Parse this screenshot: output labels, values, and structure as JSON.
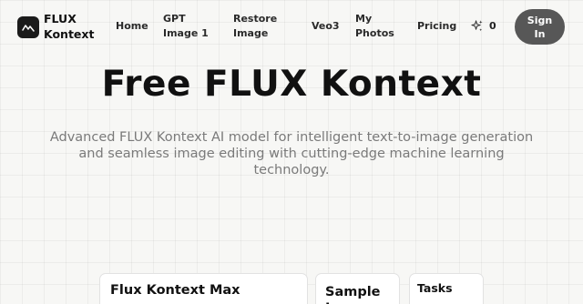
{
  "brand": {
    "line1": "FLUX",
    "line2": "Kontext"
  },
  "nav": {
    "home": "Home",
    "gpt_line1": "GPT",
    "gpt_line2": "Image 1",
    "restore_line1": "Restore",
    "restore_line2": "Image",
    "veo": "Veo3",
    "photos_line1": "My",
    "photos_line2": "Photos",
    "pricing": "Pricing",
    "credits": "0",
    "signin_line1": "Sign",
    "signin_line2": "In"
  },
  "hero": {
    "title": "Free FLUX Kontext",
    "subtitle_line1": "Advanced FLUX Kontext AI model for intelligent text-to-image generation",
    "subtitle_line2": "and seamless image editing with cutting-edge machine learning",
    "subtitle_line3": "technology."
  },
  "cards": {
    "model_title": "Flux Kontext Max",
    "sample_line1": "Sample",
    "sample_line2": "I",
    "tasks_title": "Tasks"
  },
  "icons": {
    "logo": "mountain-wave-icon",
    "credits": "sparkles-icon"
  },
  "colors": {
    "signin_bg": "#575757",
    "logo_bg": "#1b1b1b",
    "subtitle": "#7a7a7a"
  }
}
